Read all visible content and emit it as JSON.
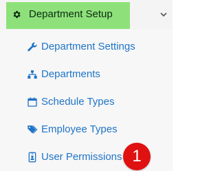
{
  "header": {
    "label": "Department Setup",
    "icon": "gear-icon",
    "expand_icon": "chevron-down-icon",
    "highlight_color": "#8ee17a"
  },
  "menu": {
    "items": [
      {
        "label": "Department Settings",
        "icon": "wrench-icon"
      },
      {
        "label": "Departments",
        "icon": "sitemap-icon"
      },
      {
        "label": "Schedule Types",
        "icon": "calendar-icon"
      },
      {
        "label": "Employee Types",
        "icon": "tags-icon"
      },
      {
        "label": "User Permissions",
        "icon": "id-badge-icon"
      }
    ],
    "link_color": "#1f74c7"
  },
  "annotation": {
    "badge_number": "1",
    "badge_color": "#e01111"
  }
}
